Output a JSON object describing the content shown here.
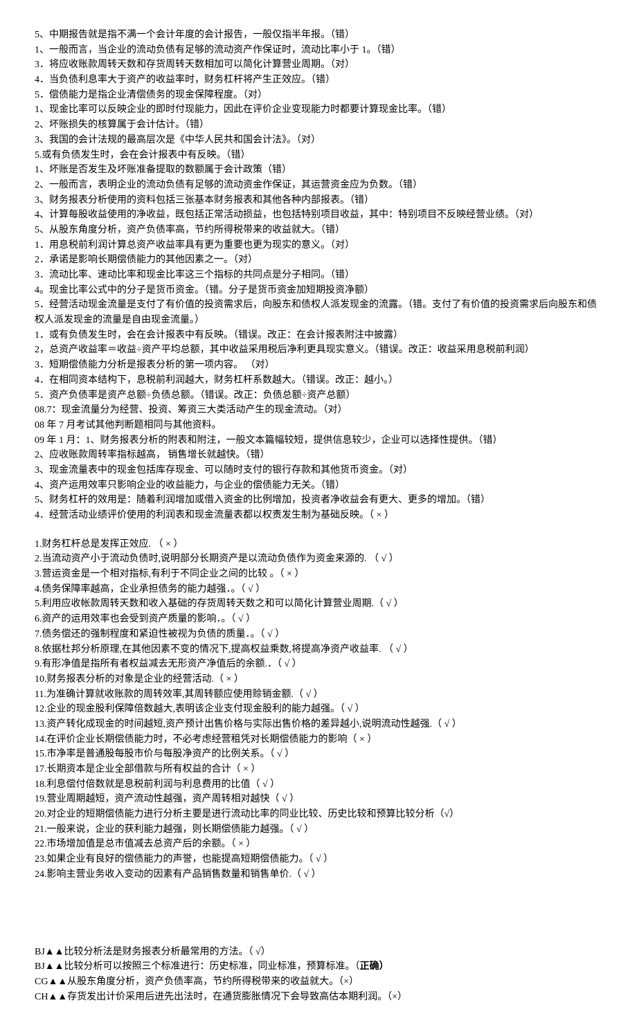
{
  "section1": [
    "5、中期报告就是指不满一个会计年度的会计报告，一般仅指半年报。（错）",
    "1、一般而言，当企业的流动负债有足够的流动资产作保证时，流动比率小于 1。（错）",
    "3．将应收账款周转天数和存货周转天数相加可以简化计算营业周期。（对）",
    "4．当负债利息率大于资产的收益率时，财务杠杆将产生正效应。（错）",
    "5．偿债能力是指企业清偿债务的现金保障程度。（对）",
    "1、现金比率可以反映企业的即时付现能力，因此在评价企业变现能力时都要计算现金比率。（错）",
    "2、坏账损失的核算属于会计估计。（错）",
    "3、我国的会计法规的最高层次是《中华人民共和国会计法》。（对）",
    "5.或有负债发生时，会在会计报表中有反映。（错）",
    "1、坏账是否发生及坏账准备提取的数额属于会计政策（错）",
    "2、一般而言，表明企业的流动负债有足够的流动资金作保证，其运营资金应为负数。（错）",
    "3、财务报表分析使用的资料包括三张基本财务报表和其他各种内部报表。（错）",
    "4、计算每股收益使用的净收益，既包括正常活动损益，也包括特别项目收益，其中：特别项目不反映经营业绩。（对）",
    "5、从股东角度分析，资产负债率高，节约所得税带来的收益就大。（错）",
    "1．用息税前利润计算总资产收益率具有更为重要也更为现实的意义。（对）",
    "2．承诺是影响长期偿债能力的其他因素之一。（对）",
    "3．流动比率、速动比率和现金比率这三个指标的共同点是分子相同。（错）",
    "4。现金比率公式中的分子是货币资金。（错。分子是货币资金加短期投资净额）",
    "5．经营活动现金流量是支付了有价值的投资需求后，向股东和债权人派发现金的流露。（错。支付了有价值的投资需求后向股东和债权人派发现金的流量是自由现金流量。）",
    "1．或有负债发生时，会在会计报表中有反映。（错误。改正：在会计报表附注中披露）",
    "2，总资产收益率＝收益÷资产平均总额，其中收益采用税后净利更具现实意义。（错误。改正：收益采用息税前利润）",
    "3．短期偿债能力分析是报表分析的第一项内容。  （对）",
    "4．在相同资本结构下，息税前利润越大，财务杠杆系数越大。（错误。改正：越小。）",
    "5．资产负债率是资产总额÷负债总额。（错误。改正：负债总额÷资产总额）",
    "08.7：现金流量分为经营、投资、筹资三大类活动产生的现金流动。（对）",
    "08 年 7 月考试其他判断题相同与其他资料。",
    "09 年 1 月：1、财务报表分析的附表和附注，一般文本篇幅较短，提供信息较少，企业可以选择性提供。（错）",
    "2、应收账款周转率指标越高，  销售增长就越快。（错）",
    "3、现金流量表中的现金包括库存现金、可以随时支付的银行存款和其他货币资金。（对）",
    "4、资产运用效率只影响企业的收益能力，与企业的偿债能力无关。（错）",
    "5、财务杠杆的效用是：随着利润增加或借入资金的比例增加，投资者净收益会有更大、更多的增加。（错）",
    "4．经营活动业绩评价使用的利润表和现金流量表都以权责发生制为基础反映。（  ×  ）"
  ],
  "section2": [
    "1.财务杠杆总是发挥正效应.  （  ×  ）",
    "2.当流动资产小于流动负债时,说明部分长期资产是以流动负债作为资金来源的. （   √  ）",
    "3.营运资金是一个相对指标,有利于不同企业之间的比较 。（ ×  ）",
    "4.债务保障率越高，企业承担债务的能力越强．。（   √   ）",
    "5.利用应收帐款周转天数和收入基础的存货周转天数之和可以简化计算营业周期.（   √   ）",
    "6.资产的运用效率也会受到资产质量的影响．。（  √  ）",
    "7.债务偿还的强制程度和紧迫性被视为负债的质量．。（    √    ）",
    "8.依据杜邦分析原理,在其他因素不变的情况下,提高权益乘数,将提高净资产收益率.  （  √  ）",
    "9.有形净值是指所有者权益减去无形资产净值后的余额.．（  √    ）",
    "10.财务报表分析的对象是企业的经营活动.（   ×   ）",
    "11.为准确计算就收账款的周转效率,其周转额应使用赊销金额.（  √ ）",
    "12.企业的现金股利保障倍数越大,表明该企业支付现金股利的能力越强。（  √  ）",
    "13.资产转化成现金的时间越短,资产预计出售价格与实际出售价格的差异越小,说明流动性越强.（  √  ）",
    "14.在评价企业长期偿债能力时，不必考虑经营租凭对长期偿债能力的影响（  ×  ）",
    "15.市净率是普通股每股市价与每股净资产的比例关系。（   √ ）",
    "17.长期资本是企业全部借款与所有权益的合计（  ×   ）",
    "18.利息偿付倍数就是息税前利润与利息费用的比值（  √  ）",
    "19.营业周期越短，资产流动性越强，资产周转相对越快（    √   ）",
    "20.对企业的短期偿债能力进行分析主要是进行流动比率的同业比较、历史比较和预算比较分析（√）",
    "21.一般来说，企业的获利能力越强，则长期偿债能力越强。（   √  ）",
    "22.市场增加值是总市值减去总资产后的余额。（   ×   ）",
    "23.如果企业有良好的偿债能力的声誉，也能提高短期偿债能力。（  √  ）",
    "24.影响主营业务收入变动的因素有产品销售数量和销售单价.（   √   ）"
  ],
  "section3": [
    {
      "prefix": "BJ▲▲比较分析法是财务报表分析最常用的方法。（  √）",
      "bold": ""
    },
    {
      "prefix": "BJ▲▲比较分析可以按照三个标准进行：历史标准，同业标准，预算标准。（",
      "bold": "正确）"
    },
    {
      "prefix": "CG▲▲从股东角度分析，资产负债率高，节约所得税带来的收益就大。（×）",
      "bold": ""
    },
    {
      "prefix": "CH▲▲存货发出计价采用后进先出法时，在通货膨胀情况下会导致高估本期利润。（×）",
      "bold": ""
    }
  ]
}
